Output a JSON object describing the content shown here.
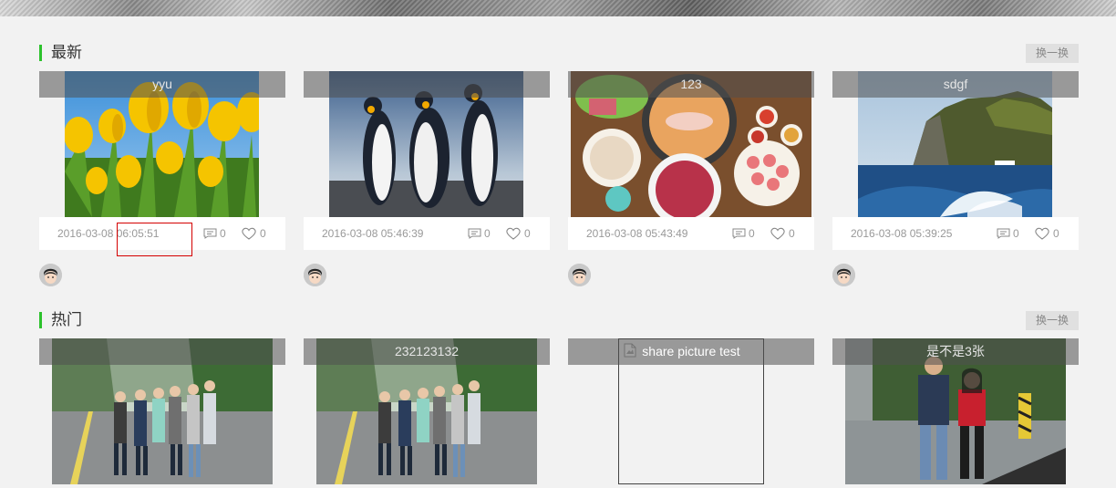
{
  "latest": {
    "title": "最新",
    "swap_label": "换一换",
    "cards": [
      {
        "title": "yyu",
        "date": "2016-03-08 06:05:51",
        "comments": "0",
        "likes": "0"
      },
      {
        "title": "",
        "date": "2016-03-08 05:46:39",
        "comments": "0",
        "likes": "0"
      },
      {
        "title": "123",
        "date": "2016-03-08 05:43:49",
        "comments": "0",
        "likes": "0"
      },
      {
        "title": "sdgf",
        "date": "2016-03-08 05:39:25",
        "comments": "0",
        "likes": "0"
      }
    ]
  },
  "hot": {
    "title": "热门",
    "swap_label": "换一换",
    "cards": [
      {
        "title": ""
      },
      {
        "title": "232123132"
      },
      {
        "title": "share picture test"
      },
      {
        "title": "是不是3张"
      }
    ]
  },
  "colors": {
    "accent": "#2cc22c",
    "highlight_border": "#d40000"
  },
  "icons": {
    "comment": "comment-icon",
    "like": "heart-icon",
    "broken_image": "broken-image-icon"
  }
}
